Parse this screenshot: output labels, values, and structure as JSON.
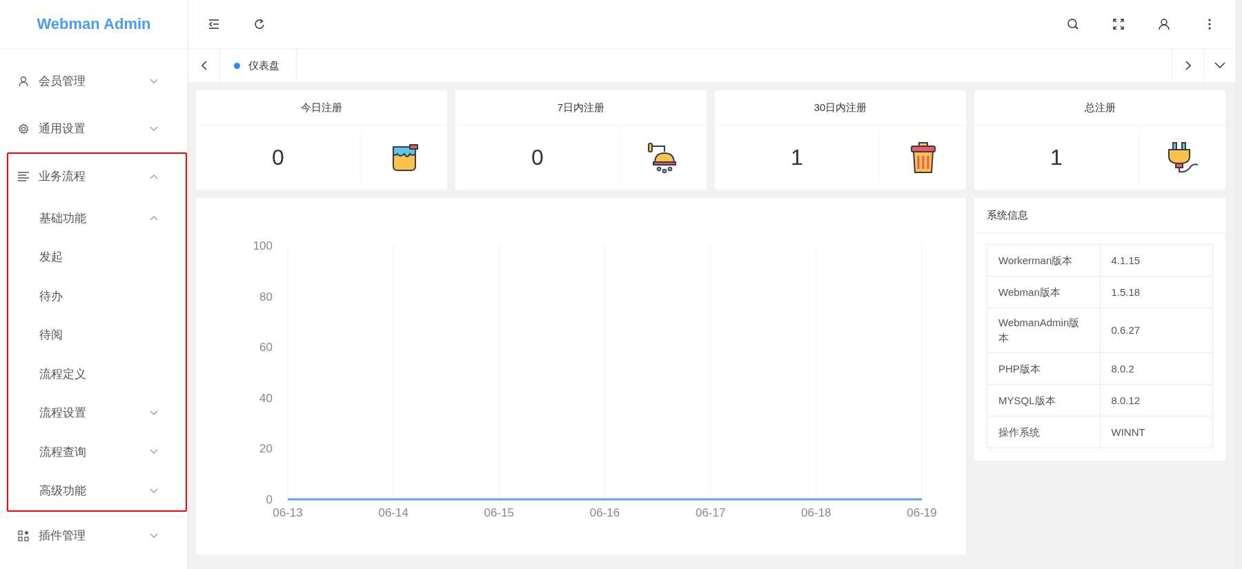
{
  "logo": "Webman Admin",
  "menu": [
    {
      "label": "会员管理",
      "expanded": false,
      "highlighted": false
    },
    {
      "label": "通用设置",
      "expanded": false,
      "highlighted": false
    },
    {
      "label": "业务流程",
      "expanded": true,
      "highlighted": true,
      "children": [
        {
          "label": "基础功能",
          "expanded": true,
          "children": [
            {
              "label": "发起"
            },
            {
              "label": "待办"
            },
            {
              "label": "待阅"
            },
            {
              "label": "流程定义"
            }
          ]
        },
        {
          "label": "流程设置",
          "expanded": false
        },
        {
          "label": "流程查询",
          "expanded": false
        },
        {
          "label": "高级功能",
          "expanded": false
        }
      ]
    },
    {
      "label": "插件管理",
      "expanded": false,
      "highlighted": false
    }
  ],
  "tabs": [
    {
      "label": "仪表盘",
      "selected": true
    }
  ],
  "stats": [
    {
      "title": "今日注册",
      "value": "0"
    },
    {
      "title": "7日内注册",
      "value": "0"
    },
    {
      "title": "30日内注册",
      "value": "1"
    },
    {
      "title": "总注册",
      "value": "1"
    }
  ],
  "chart_data": {
    "type": "line",
    "categories": [
      "06-13",
      "06-14",
      "06-15",
      "06-16",
      "06-17",
      "06-18",
      "06-19"
    ],
    "series": [
      {
        "color": "#5aa5f5",
        "values": [
          0,
          0,
          0,
          0,
          0,
          0,
          0
        ]
      }
    ],
    "grid": true,
    "ylim": [
      0,
      100
    ],
    "yticks": [
      0,
      20,
      40,
      60,
      80,
      100
    ]
  },
  "system_info": {
    "title": "系统信息",
    "rows": [
      {
        "label": "Workerman版本",
        "value": "4.1.15"
      },
      {
        "label": "Webman版本",
        "value": "1.5.18"
      },
      {
        "label": "WebmanAdmin版本",
        "value": "0.6.27"
      },
      {
        "label": "PHP版本",
        "value": "8.0.2"
      },
      {
        "label": "MYSQL版本",
        "value": "8.0.12"
      },
      {
        "label": "操作系统",
        "value": "WINNT"
      }
    ]
  }
}
